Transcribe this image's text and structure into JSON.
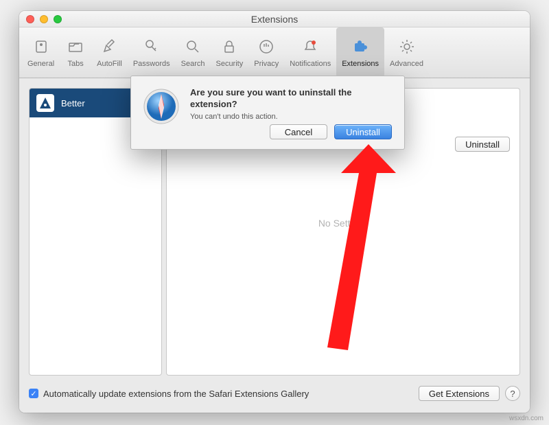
{
  "window": {
    "title": "Extensions"
  },
  "toolbar": {
    "items": [
      {
        "label": "General"
      },
      {
        "label": "Tabs"
      },
      {
        "label": "AutoFill"
      },
      {
        "label": "Passwords"
      },
      {
        "label": "Search"
      },
      {
        "label": "Security"
      },
      {
        "label": "Privacy"
      },
      {
        "label": "Notifications"
      },
      {
        "label": "Extensions"
      },
      {
        "label": "Advanced"
      }
    ]
  },
  "sidebar": {
    "items": [
      {
        "name": "Better"
      }
    ]
  },
  "main": {
    "no_settings": "No Settings",
    "uninstall_button": "Uninstall"
  },
  "footer": {
    "auto_update_label": "Automatically update extensions from the Safari Extensions Gallery",
    "get_extensions": "Get Extensions",
    "help": "?"
  },
  "dialog": {
    "title": "Are you sure you want to uninstall the extension?",
    "message": "You can't undo this action.",
    "cancel": "Cancel",
    "confirm": "Uninstall"
  },
  "watermark": "wsxdn.com"
}
